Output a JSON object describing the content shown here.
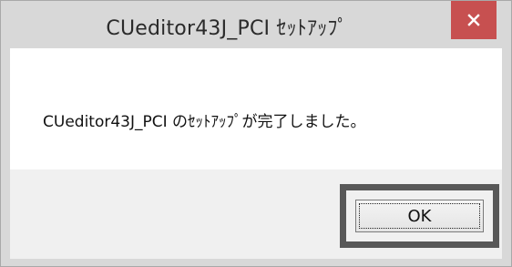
{
  "window": {
    "title": "CUeditor43J_PCI ｾｯﾄｱｯﾌﾟ"
  },
  "dialog": {
    "message": "CUeditor43J_PCI のｾｯﾄｱｯﾌﾟが完了しました。",
    "ok_label": "OK"
  },
  "icons": {
    "close": "close-icon"
  },
  "colors": {
    "close_button": "#c75050",
    "titlebar": "#d8d8d8",
    "footer": "#f0f0f0",
    "focus_frame": "#585858"
  }
}
